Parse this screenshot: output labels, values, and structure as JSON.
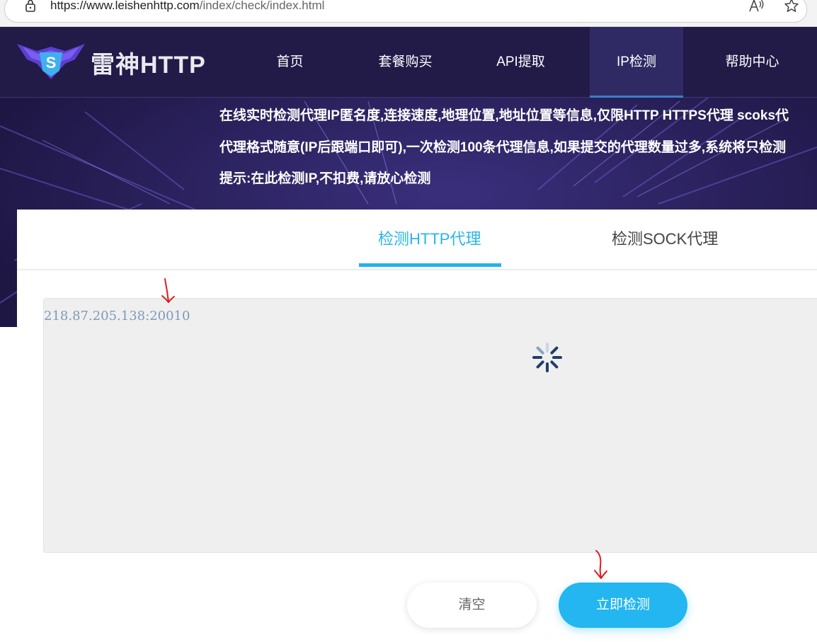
{
  "browser": {
    "url_host": "https://www.leishenhttp.com",
    "url_path": "/index/check/index.html",
    "icons": [
      "lock-icon",
      "read-aloud-icon",
      "star-icon"
    ]
  },
  "site": {
    "logo_text": "雷神HTTP",
    "nav": [
      {
        "label": "首页",
        "active": false
      },
      {
        "label": "套餐购买",
        "active": false
      },
      {
        "label": "API提取",
        "active": false
      },
      {
        "label": "IP检测",
        "active": true
      },
      {
        "label": "帮助中心",
        "active": false
      }
    ]
  },
  "notice": {
    "line1": "在线实时检测代理IP匿名度,连接速度,地理位置,地址位置等信息,仅限HTTP HTTPS代理 scoks代",
    "line2": "代理格式随意(IP后跟端口即可),一次检测100条代理信息,如果提交的代理数量过多,系统将只检测",
    "line3": "提示:在此检测IP,不扣费,请放心检测"
  },
  "tabs": [
    {
      "label": "检测HTTP代理",
      "active": true
    },
    {
      "label": "检测SOCK代理",
      "active": false
    }
  ],
  "proxy_input": {
    "value": "218.87.205.138:20010"
  },
  "buttons": {
    "clear": "清空",
    "check": "立即检测"
  },
  "colors": {
    "nav_bg": "#221a47",
    "accent": "#23b6f0",
    "annotation": "#e0191b"
  }
}
